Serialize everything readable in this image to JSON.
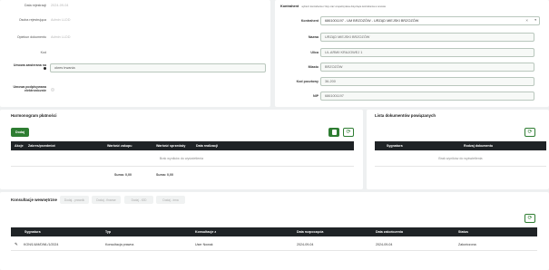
{
  "left_form": {
    "fields": [
      {
        "label": "Data rejestracji",
        "value": "2024-09-04"
      },
      {
        "label": "Osoba rejestrująca",
        "value": "Admin LLDD"
      },
      {
        "label": "Opiekun dokumentu",
        "value": "Admin LLDD"
      },
      {
        "label": "Kod",
        "value": ""
      }
    ],
    "duration_label": "Umowa zawierana na",
    "duration_value": "okres trwania",
    "signed_label": "Umowa podpisywana elektronicznie"
  },
  "contractor": {
    "heading": "Kontrahent",
    "note": "wybierz kontrahenta z listy oraz uzupełnij dane dotyczące kontrahenta w umowie",
    "select_label": "Kontrahent",
    "select_value": "6861001197 - UM BRZOZÓW - URZĄD MIEJSKI BRZOZÓW",
    "fields": [
      {
        "label": "Nazwa",
        "value": "URZĄD MIEJSKI BRZOZÓW"
      },
      {
        "label": "Ulica",
        "value": "UL.ARMII KRAJOWEJ 1"
      },
      {
        "label": "Miasto",
        "value": "BRZOZÓW"
      },
      {
        "label": "Kod pocztowy",
        "value": "36-200"
      },
      {
        "label": "NIP",
        "value": "6861001197"
      }
    ]
  },
  "schedule": {
    "title": "Harmonogram płatności",
    "add_label": "Dodaj",
    "columns": [
      "Akcje",
      "Zakres/przedmiot",
      "Wartość zakupu",
      "Wartość sprzedaży",
      "Data realizacji"
    ],
    "empty_text": "Brak wyników do wyświetlenia",
    "sum1": "Suma: 0,00",
    "sum2": "Suma: 0,00"
  },
  "related": {
    "title": "Lista dokumentów powiązanych",
    "columns": [
      "Sygnatura",
      "Rodzaj dokumentu"
    ],
    "empty_text": "Brak wyników do wyświetlenia"
  },
  "consult": {
    "title": "Konsultacje wewnętrzne",
    "tabs": [
      "Dodaj - prawnik",
      "Dodaj - finanse",
      "Dodaj - IOD",
      "Dodaj - inna"
    ],
    "columns": [
      "Sygnatura",
      "Typ",
      "Konsultacje z",
      "Data rozpoczęcia",
      "Data zakończenia",
      "Status"
    ],
    "rows": [
      {
        "sygnatura": "KON/1/UM/DWL/1/2024",
        "typ": "Konsultacja prawna",
        "z": "User Nowak",
        "start": "2024-09-04",
        "end": "2024-09-04",
        "status": "Zakończona"
      }
    ]
  },
  "colors": {
    "accent": "#2e7d32",
    "header": "#1f2326"
  }
}
